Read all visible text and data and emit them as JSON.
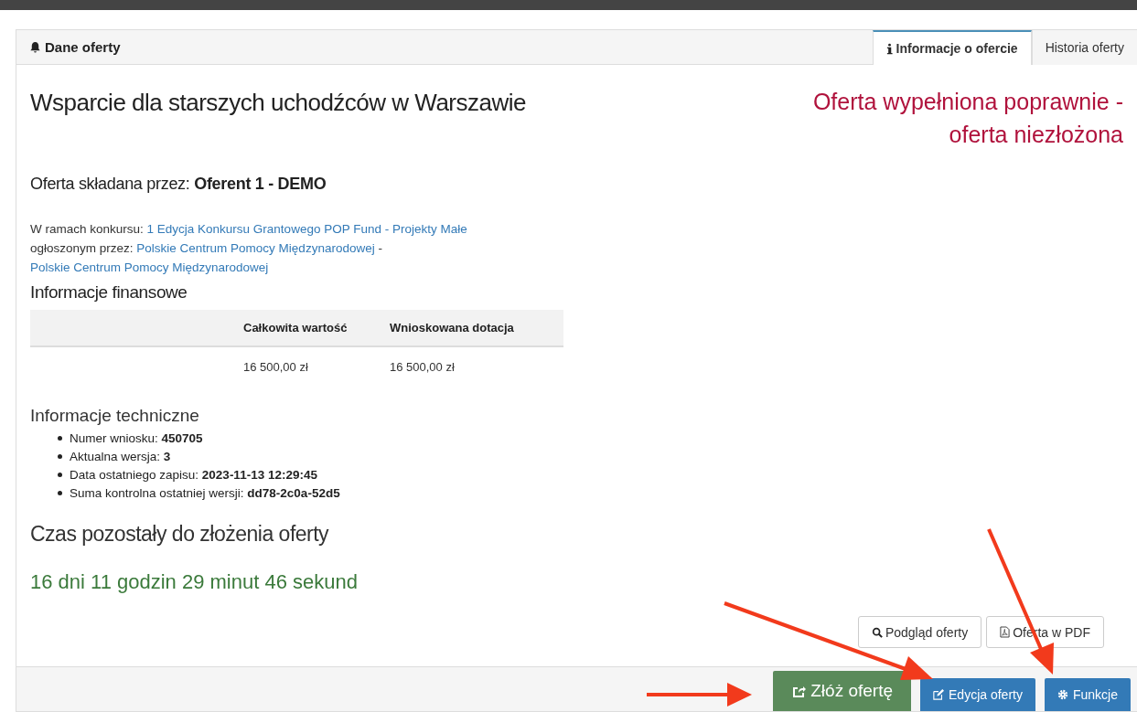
{
  "panel": {
    "title": "Dane oferty"
  },
  "tabs": [
    {
      "label": "Informacje o ofercie",
      "selected": true
    },
    {
      "label": "Historia oferty",
      "selected": false
    }
  ],
  "offer": {
    "title": "Wsparcie dla starszych uchodźców w Warszawie",
    "status": "Oferta wypełniona poprawnie - oferta niezłożona",
    "submitter_label": "Oferta składana przez:",
    "submitter": "Oferent 1 - DEMO"
  },
  "contest": {
    "label": "W ramach konkursu:",
    "link": "1 Edycja Konkursu Grantowego POP Fund - Projekty Małe",
    "announced_label": "ogłoszonym przez:",
    "org_link": "Polskie Centrum Pomocy Międzynarodowej",
    "separator": "-",
    "org_link_2": "Polskie Centrum Pomocy Międzynarodowej"
  },
  "finance": {
    "heading": "Informacje finansowe",
    "columns": [
      "Całkowita wartość",
      "Wnioskowana dotacja"
    ],
    "values": [
      "16 500,00 zł",
      "16 500,00 zł"
    ]
  },
  "technical": {
    "heading": "Informacje techniczne",
    "items": [
      {
        "label": "Numer wniosku:",
        "value": "450705"
      },
      {
        "label": "Aktualna wersja:",
        "value": "3"
      },
      {
        "label": "Data ostatniego zapisu:",
        "value": "2023-11-13 12:29:45"
      },
      {
        "label": "Suma kontrolna ostatniej wersji:",
        "value": "dd78-2c0a-52d5"
      }
    ]
  },
  "countdown": {
    "heading": "Czas pozostały do złożenia oferty",
    "value": "16 dni 11 godzin 29 minut 46 sekund"
  },
  "document_buttons": [
    {
      "label": "Podgląd oferty"
    },
    {
      "label": "Oferta w PDF"
    }
  ],
  "footer_buttons": [
    {
      "label": "Złóż ofertę",
      "kind": "success"
    },
    {
      "label": "Edycja oferty",
      "kind": "primary"
    },
    {
      "label": "Funkcje",
      "kind": "primary"
    }
  ]
}
